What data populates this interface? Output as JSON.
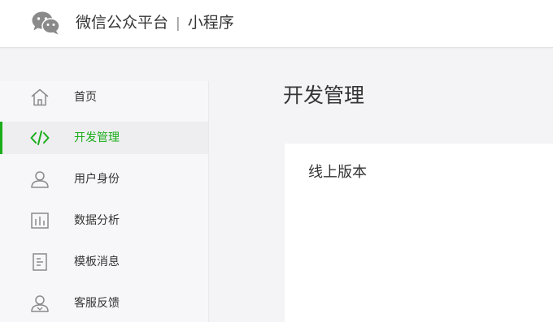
{
  "header": {
    "brand_name": "微信公众平台",
    "separator": "|",
    "product": "小程序",
    "logo_icon": "wechat-logo-icon"
  },
  "sidebar": {
    "items": [
      {
        "label": "首页",
        "icon": "home-icon",
        "active": false
      },
      {
        "label": "开发管理",
        "icon": "code-icon",
        "active": true
      },
      {
        "label": "用户身份",
        "icon": "user-icon",
        "active": false
      },
      {
        "label": "数据分析",
        "icon": "bar-chart-icon",
        "active": false
      },
      {
        "label": "模板消息",
        "icon": "document-icon",
        "active": false
      },
      {
        "label": "客服反馈",
        "icon": "customer-service-icon",
        "active": false
      }
    ]
  },
  "main": {
    "title": "开发管理",
    "card": {
      "title": "线上版本"
    }
  },
  "colors": {
    "accent": "#1aad19",
    "text": "#353535",
    "icon": "#8a8a8a"
  }
}
